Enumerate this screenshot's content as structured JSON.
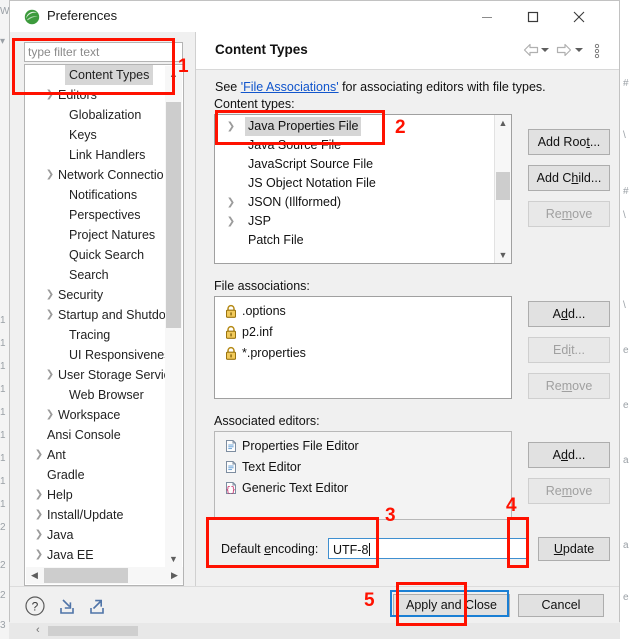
{
  "window": {
    "title": "Preferences",
    "app_icon": "eclipse-icon",
    "controls": {
      "minimize": "minimize-icon",
      "maximize": "maximize-icon",
      "close": "close-icon"
    }
  },
  "filter": {
    "placeholder": "type filter text",
    "value": ""
  },
  "sidebar": {
    "items": [
      {
        "label": "Content Types",
        "indent": 2,
        "expandable": false,
        "selected": true
      },
      {
        "label": "Editors",
        "indent": 1,
        "expandable": true,
        "selected": false
      },
      {
        "label": "Globalization",
        "indent": 2,
        "expandable": false,
        "selected": false
      },
      {
        "label": "Keys",
        "indent": 2,
        "expandable": false,
        "selected": false
      },
      {
        "label": "Link Handlers",
        "indent": 2,
        "expandable": false,
        "selected": false
      },
      {
        "label": "Network Connectio",
        "indent": 1,
        "expandable": true,
        "selected": false
      },
      {
        "label": "Notifications",
        "indent": 2,
        "expandable": false,
        "selected": false
      },
      {
        "label": "Perspectives",
        "indent": 2,
        "expandable": false,
        "selected": false
      },
      {
        "label": "Project Natures",
        "indent": 2,
        "expandable": false,
        "selected": false
      },
      {
        "label": "Quick Search",
        "indent": 2,
        "expandable": false,
        "selected": false
      },
      {
        "label": "Search",
        "indent": 2,
        "expandable": false,
        "selected": false
      },
      {
        "label": "Security",
        "indent": 1,
        "expandable": true,
        "selected": false
      },
      {
        "label": "Startup and Shutdo",
        "indent": 1,
        "expandable": true,
        "selected": false
      },
      {
        "label": "Tracing",
        "indent": 2,
        "expandable": false,
        "selected": false
      },
      {
        "label": "UI Responsiveness",
        "indent": 2,
        "expandable": false,
        "selected": false
      },
      {
        "label": "User Storage Servic",
        "indent": 1,
        "expandable": true,
        "selected": false
      },
      {
        "label": "Web Browser",
        "indent": 2,
        "expandable": false,
        "selected": false
      },
      {
        "label": "Workspace",
        "indent": 1,
        "expandable": true,
        "selected": false
      },
      {
        "label": "Ansi Console",
        "indent": 0,
        "expandable": false,
        "selected": false
      },
      {
        "label": "Ant",
        "indent": 0,
        "expandable": true,
        "selected": false
      },
      {
        "label": "Gradle",
        "indent": 0,
        "expandable": false,
        "selected": false
      },
      {
        "label": "Help",
        "indent": 0,
        "expandable": true,
        "selected": false
      },
      {
        "label": "Install/Update",
        "indent": 0,
        "expandable": true,
        "selected": false
      },
      {
        "label": "Java",
        "indent": 0,
        "expandable": true,
        "selected": false
      },
      {
        "label": "Java EE",
        "indent": 0,
        "expandable": true,
        "selected": false
      }
    ],
    "scrollbar_vertical": "tree-vertical-scrollbar",
    "scrollbar_horizontal": "tree-horizontal-scrollbar"
  },
  "page": {
    "title": "Content Types",
    "nav": {
      "back": "back-arrow-icon",
      "forward": "forward-arrow-icon",
      "menu": "view-menu-icon"
    },
    "description_prefix": "See ",
    "description_link": "'File Associations'",
    "description_suffix": " for associating editors with file types."
  },
  "content_types": {
    "label": "Content types:",
    "rows": [
      {
        "label": "Java Properties File",
        "expandable": true,
        "selected": true
      },
      {
        "label": "Java Source File",
        "expandable": false,
        "selected": false
      },
      {
        "label": "JavaScript Source File",
        "expandable": false,
        "selected": false
      },
      {
        "label": "JS Object Notation File",
        "expandable": false,
        "selected": false
      },
      {
        "label": "JSON (Illformed)",
        "expandable": true,
        "selected": false
      },
      {
        "label": "JSP",
        "expandable": true,
        "selected": false
      },
      {
        "label": "Patch File",
        "expandable": false,
        "selected": false
      }
    ],
    "buttons": [
      {
        "label": "Add Root...",
        "mnemonic": "t",
        "disabled": false
      },
      {
        "label": "Add Child...",
        "mnemonic": "h",
        "disabled": false
      },
      {
        "label": "Remove",
        "mnemonic": "m",
        "disabled": true
      }
    ]
  },
  "file_associations": {
    "label": "File associations:",
    "rows": [
      {
        "label": ".options",
        "icon": "lock-icon"
      },
      {
        "label": "p2.inf",
        "icon": "lock-icon"
      },
      {
        "label": "*.properties",
        "icon": "lock-icon"
      }
    ],
    "buttons": [
      {
        "label": "Add...",
        "mnemonic": "d",
        "disabled": false
      },
      {
        "label": "Edit...",
        "mnemonic": "i",
        "disabled": true
      },
      {
        "label": "Remove",
        "mnemonic": "m",
        "disabled": true
      }
    ]
  },
  "associated_editors": {
    "label": "Associated editors:",
    "rows": [
      {
        "label": "Properties File Editor",
        "icon": "document-icon"
      },
      {
        "label": "Text Editor",
        "icon": "document-icon"
      },
      {
        "label": "Generic Text Editor",
        "icon": "generic-text-editor-icon"
      }
    ],
    "buttons": [
      {
        "label": "Add...",
        "mnemonic": "d",
        "disabled": false
      },
      {
        "label": "Remove",
        "mnemonic": "m",
        "disabled": true
      }
    ]
  },
  "encoding": {
    "label": "Default encoding:",
    "value": "UTF-8",
    "update_button": "Update"
  },
  "bottom_bar": {
    "icons": [
      {
        "name": "help-icon",
        "label": "?"
      },
      {
        "name": "import-icon",
        "label": ""
      },
      {
        "name": "export-icon",
        "label": ""
      }
    ],
    "apply_and_close": "Apply and Close",
    "cancel": "Cancel"
  },
  "annotations": {
    "numbers": [
      "1",
      "2",
      "3",
      "4",
      "5"
    ],
    "color": "#ff1100",
    "focus_color": "#1a7fd4"
  },
  "background_text": {
    "left": [
      "W",
      "",
      "",
      "1",
      "1",
      "1",
      "1",
      "1",
      "1",
      "1",
      "1",
      "2",
      "2",
      "2",
      "3"
    ],
    "right": [
      "#",
      "\\",
      "#",
      "\\",
      "\\",
      "e",
      "e",
      "a",
      "a",
      "e"
    ]
  }
}
